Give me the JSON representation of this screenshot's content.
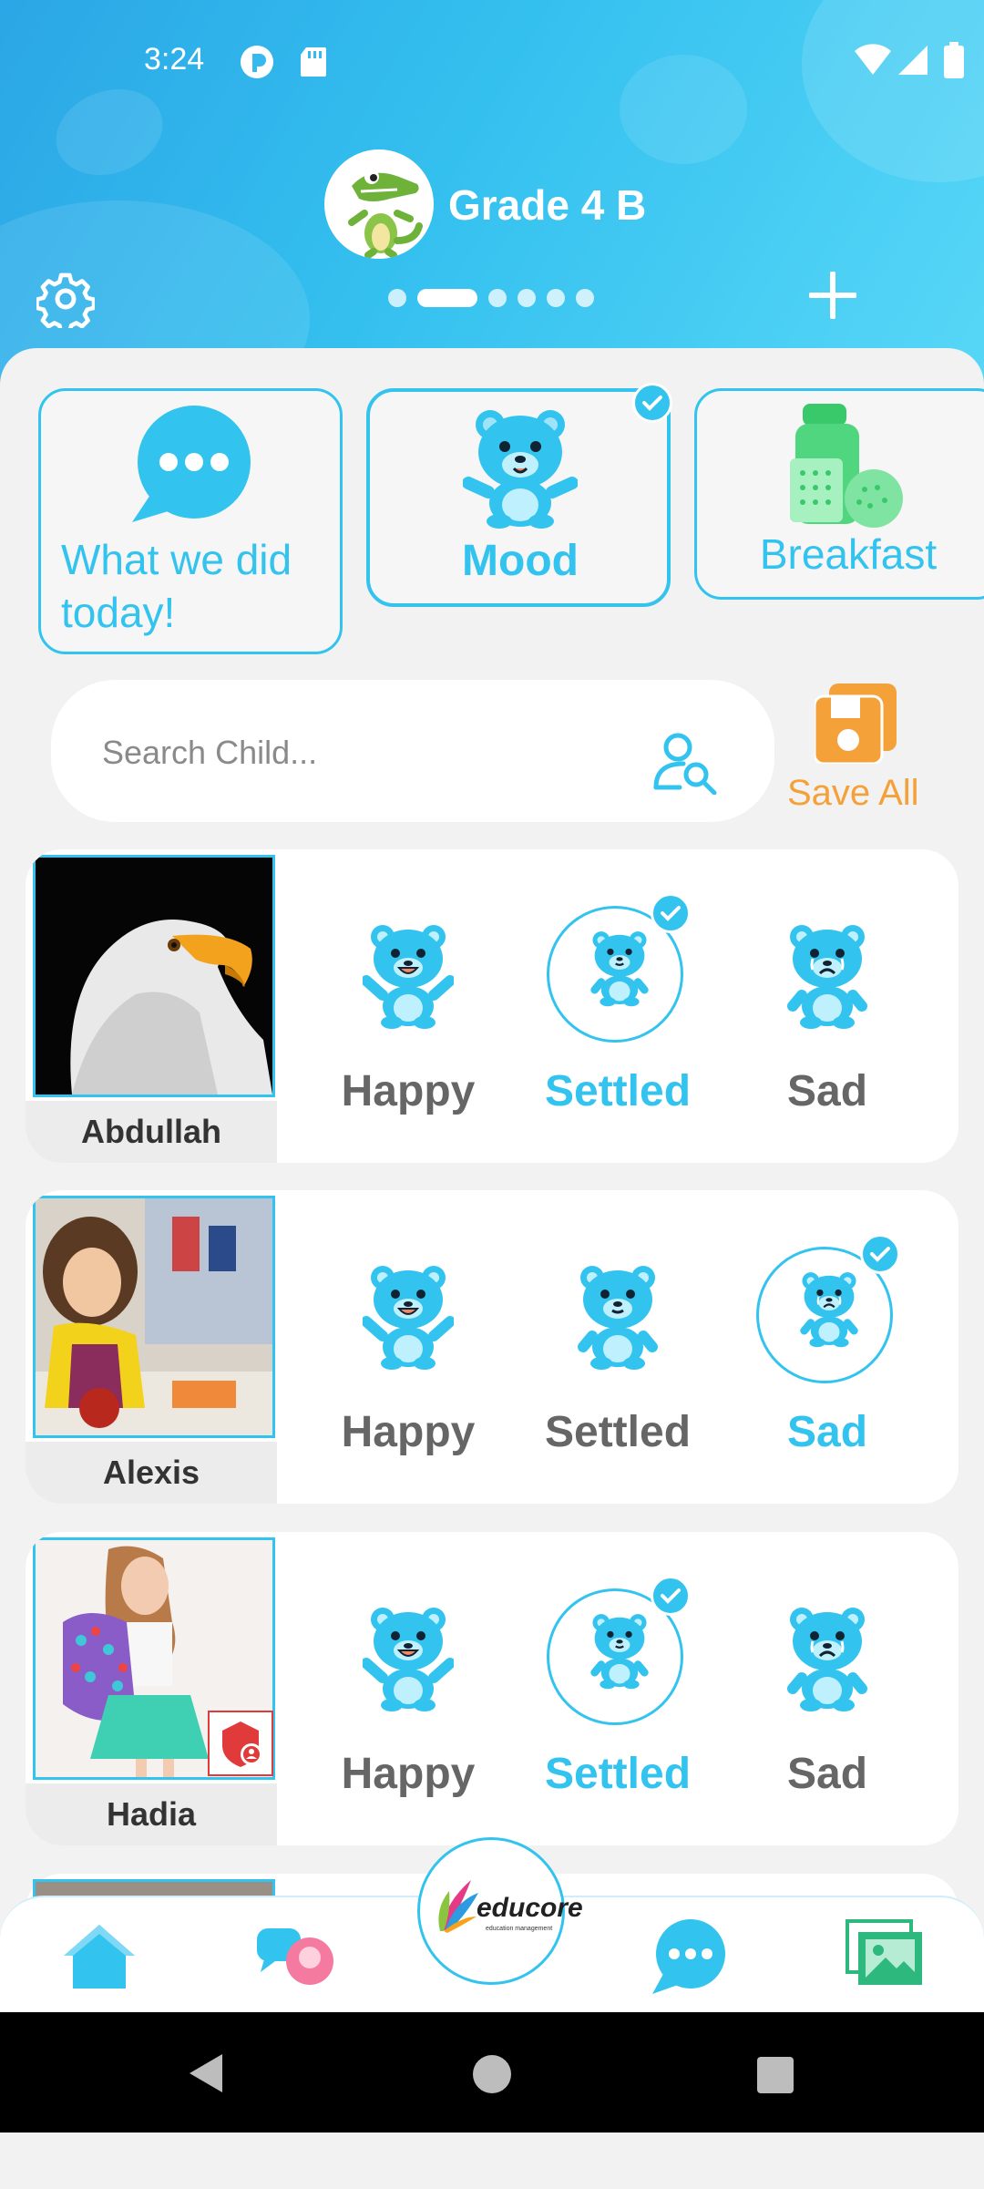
{
  "status_bar": {
    "time": "3:24"
  },
  "header": {
    "class_title": "Grade 4 B",
    "page_dots": 6,
    "active_dot": 1
  },
  "categories": [
    {
      "label": "What we did today!",
      "icon": "chat-bubble-icon",
      "selected": false
    },
    {
      "label": "Mood",
      "icon": "bear-icon",
      "selected": true
    },
    {
      "label": "Breakfast",
      "icon": "breakfast-icon",
      "selected": false
    }
  ],
  "search": {
    "placeholder": "Search Child..."
  },
  "save_all": {
    "label": "Save All"
  },
  "moods": [
    "Happy",
    "Settled",
    "Sad"
  ],
  "children": [
    {
      "name": "Abdullah",
      "selected_mood": "Settled"
    },
    {
      "name": "Alexis",
      "selected_mood": "Sad"
    },
    {
      "name": "Hadia",
      "selected_mood": "Settled"
    }
  ],
  "bottom_nav": {
    "logo_text": "educore",
    "logo_subtext": "education management"
  },
  "colors": {
    "accent": "#33c3ef",
    "save": "#f5a13a",
    "header_start": "#2ba6e6",
    "header_end": "#57d7f7"
  }
}
